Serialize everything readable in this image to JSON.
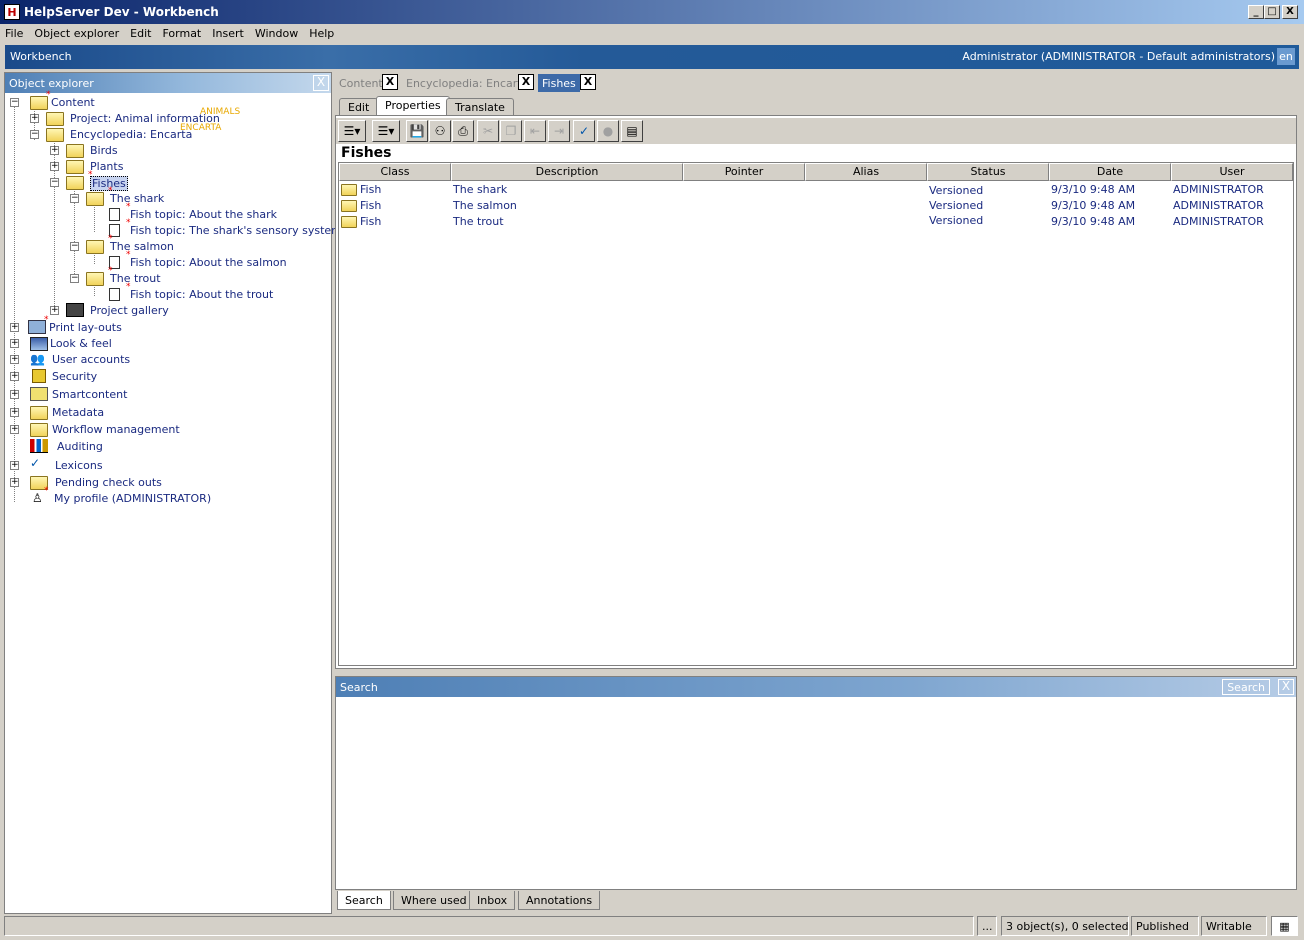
{
  "window": {
    "title": "HelpServer Dev - Workbench",
    "min": "_",
    "max": "□",
    "close": "X"
  },
  "menu": [
    "File",
    "Object explorer",
    "Edit",
    "Format",
    "Insert",
    "Window",
    "Help"
  ],
  "banner": {
    "left": "Workbench",
    "user": "Administrator (ADMINISTRATOR - Default administrators)",
    "lang": "en"
  },
  "object_explorer": {
    "title": "Object explorer",
    "close": "X",
    "tree": {
      "content": "Content",
      "project_animal": "Project: Animal information",
      "project_animal_tag": "ANIMALS",
      "encyclopedia": "Encyclopedia: Encarta",
      "encyclopedia_tag": "ENCARTA",
      "birds": "Birds",
      "plants": "Plants",
      "fishes": "Fishes",
      "shark": "The shark",
      "shark_t1": "Fish topic: About the shark",
      "shark_t2": "Fish topic: The shark's sensory system",
      "salmon": "The salmon",
      "salmon_t1": "Fish topic: About the salmon",
      "trout": "The trout",
      "trout_t1": "Fish topic: About the trout",
      "gallery": "Project gallery",
      "print": "Print lay-outs",
      "look": "Look & feel",
      "users": "User accounts",
      "security": "Security",
      "smart": "Smartcontent",
      "metadata": "Metadata",
      "workflow": "Workflow management",
      "auditing": "Auditing",
      "lexicons": "Lexicons",
      "pending": "Pending check outs",
      "profile": "My profile (ADMINISTRATOR)"
    }
  },
  "doc_tabs": {
    "tab1": "Content",
    "tab2": "Encyclopedia: Encarta",
    "tab3": "Fishes",
    "close": "X"
  },
  "sub_tabs": {
    "edit": "Edit",
    "properties": "Properties",
    "translate": "Translate"
  },
  "list": {
    "title": "Fishes",
    "columns": [
      "Class",
      "Description",
      "Pointer",
      "Alias",
      "Status",
      "Date",
      "User"
    ],
    "rows": [
      {
        "class": "Fish",
        "description": "The shark",
        "status": "Versioned",
        "date": "9/3/10 9:48 AM",
        "user": "ADMINISTRATOR"
      },
      {
        "class": "Fish",
        "description": "The salmon",
        "status": "Versioned",
        "date": "9/3/10 9:48 AM",
        "user": "ADMINISTRATOR"
      },
      {
        "class": "Fish",
        "description": "The trout",
        "status": "Versioned",
        "date": "9/3/10 9:48 AM",
        "user": "ADMINISTRATOR"
      }
    ]
  },
  "search_panel": {
    "title": "Search",
    "button": "Search",
    "close": "X"
  },
  "bottom_tabs": [
    "Search",
    "Where used",
    "Inbox",
    "Annotations"
  ],
  "status": {
    "dots": "...",
    "count": "3 object(s), 0 selected",
    "state": "Published",
    "mode": "Writable"
  }
}
